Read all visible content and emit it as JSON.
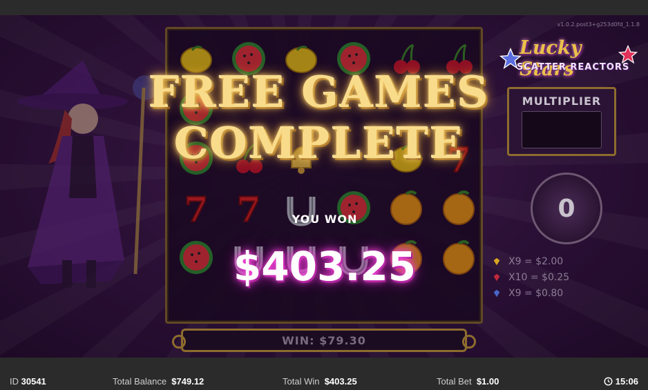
{
  "version": "v1.0.2.post3+g253d0fd_1.1.8",
  "overlay": {
    "title_line1": "FREE GAMES",
    "title_line2": "COMPLETE",
    "you_won_label": "YOU WON",
    "amount": "$403.25"
  },
  "win_bar": {
    "text": "WIN: $79.30"
  },
  "logo": {
    "line1": "Lucky Stars",
    "line2": "SCATTER REACTORS"
  },
  "multiplier": {
    "label": "MULTIPLIER",
    "counter": "0"
  },
  "paytable": [
    {
      "icon": "yellow-gem-icon",
      "color": "#d8a623",
      "text": "X9 = $2.00"
    },
    {
      "icon": "red-gem-icon",
      "color": "#c0283a",
      "text": "X10 = $0.25"
    },
    {
      "icon": "blue-gem-icon",
      "color": "#4866c9",
      "text": "X9 = $0.80"
    }
  ],
  "reels": [
    [
      "lemon",
      "watermelon",
      "watermelon",
      "seven",
      "watermelon"
    ],
    [
      "watermelon",
      "blank",
      "cherry",
      "seven",
      "horseshoe"
    ],
    [
      "lemon",
      "blank",
      "bell",
      "horseshoe",
      "horseshoe"
    ],
    [
      "watermelon",
      "blank",
      "blank",
      "watermelon",
      "horseshoe"
    ],
    [
      "cherry",
      "blank",
      "lemon",
      "orange",
      "orange"
    ],
    [
      "cherry",
      "blank",
      "seven",
      "orange",
      "orange"
    ]
  ],
  "bottom_bar": {
    "id_label": "ID",
    "id_value": "30541",
    "balance_label": "Total Balance",
    "balance_value": "$749.12",
    "win_label": "Total Win",
    "win_value": "$403.25",
    "bet_label": "Total Bet",
    "bet_value": "$1.00",
    "clock": "15:06"
  },
  "colors": {
    "gold_frame": "#8d6c2e",
    "title_gold": "#f8dc8b",
    "amount_glow": "#ff4fe0"
  }
}
